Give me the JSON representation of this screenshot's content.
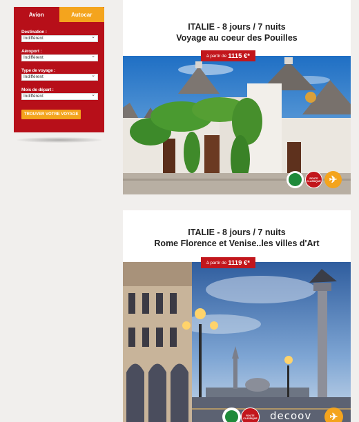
{
  "search": {
    "tabs": [
      "Avion",
      "Autocar"
    ],
    "fields": [
      {
        "label": "Destination :",
        "value": "Indifférent"
      },
      {
        "label": "Aéroport :",
        "value": "Indifférent"
      },
      {
        "label": "Type de voyage :",
        "value": "Indifférent"
      },
      {
        "label": "Mois de départ :",
        "value": "Indifférent"
      }
    ],
    "submit_label": "TROUVER VOTRE VOYAGE"
  },
  "offers": [
    {
      "title_line1": "ITALIE - 8 jours / 7 nuits",
      "title_line2": "Voyage au coeur des Pouilles",
      "price_prefix": "à partir de",
      "price": "1115 €*",
      "badges": [
        "green-guide-icon",
        "red-route-icon",
        "plane-icon"
      ],
      "red_badge_text": "ROUTE CLASSIQUE"
    },
    {
      "title_line1": "ITALIE - 8 jours / 7 nuits",
      "title_line2": "Rome Florence et Venise..les villes d'Art",
      "price_prefix": "à partir de",
      "price": "1119 €*",
      "badges": [
        "green-guide-icon",
        "red-route-icon",
        "plane-icon"
      ],
      "red_badge_text": "ROUTE CLASSIQUE",
      "brand": "decoov"
    }
  ],
  "colors": {
    "brand_red": "#b70f19",
    "accent_orange": "#f4a41d",
    "page_bg": "#f1efed"
  }
}
